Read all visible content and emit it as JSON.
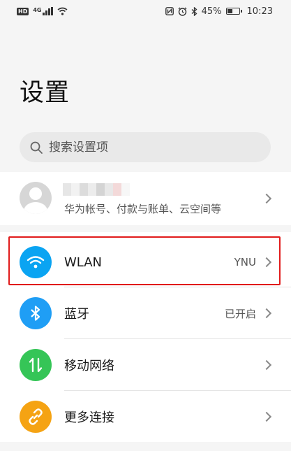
{
  "status_bar": {
    "hd_label": "HD",
    "network_label": "4G",
    "battery_percent": "45%",
    "battery_level": 0.45,
    "time": "10:23"
  },
  "page": {
    "title": "设置"
  },
  "search": {
    "placeholder": "搜索设置项"
  },
  "account": {
    "subtitle": "华为帐号、付款与账单、云空间等"
  },
  "items": [
    {
      "label": "WLAN",
      "value": "YNU",
      "icon": "wifi-icon",
      "color": "#0aa4f2"
    },
    {
      "label": "蓝牙",
      "value": "已开启",
      "icon": "bluetooth-icon",
      "color": "#1f9ef5"
    },
    {
      "label": "移动网络",
      "value": "",
      "icon": "mobile-data-icon",
      "color": "#35c557"
    },
    {
      "label": "更多连接",
      "value": "",
      "icon": "link-icon",
      "color": "#f5a313"
    }
  ],
  "highlight_color": "#e11b1b"
}
